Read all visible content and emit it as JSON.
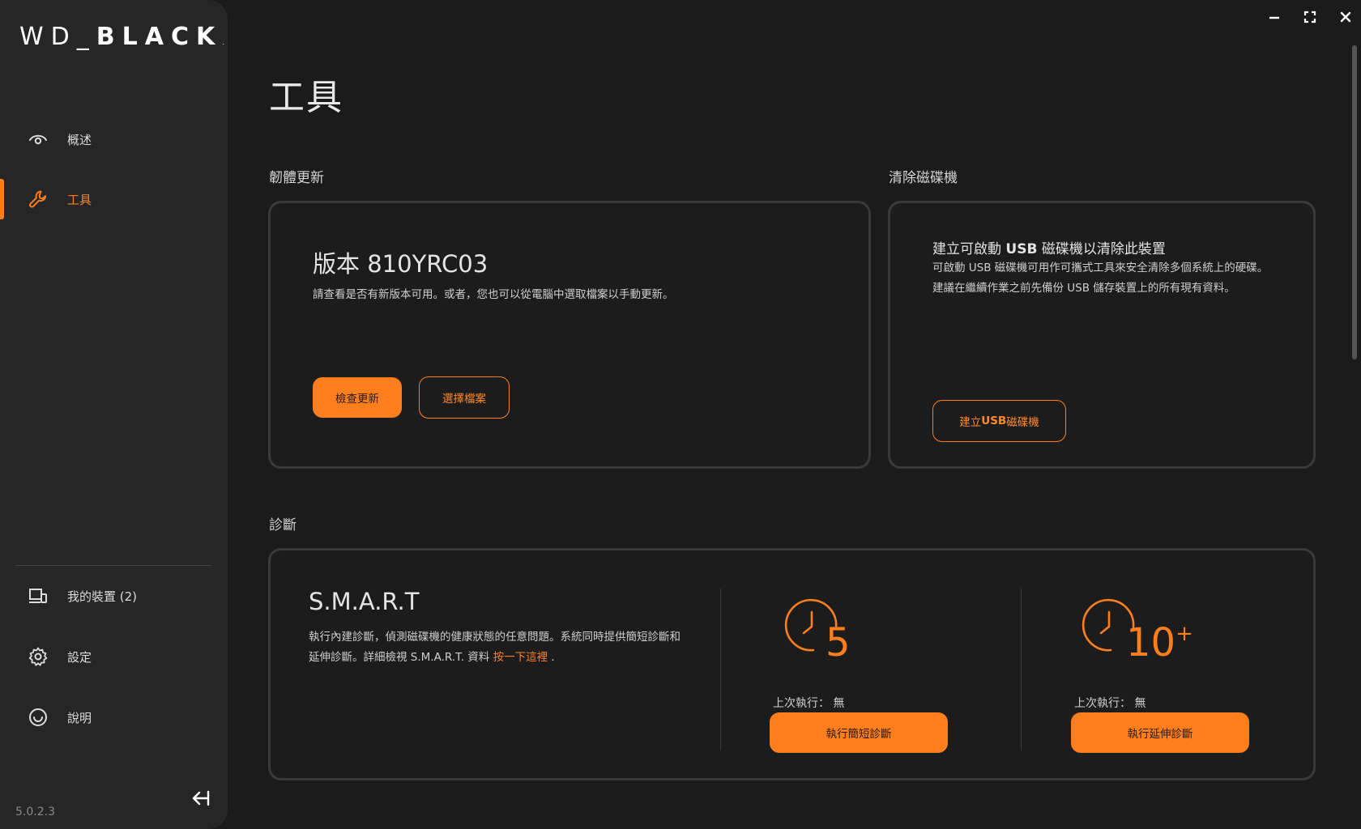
{
  "sidebar": {
    "logo": {
      "part1": "WD_",
      "part2": "BLACK",
      "mark": "."
    },
    "nav": [
      {
        "label": "概述",
        "icon": "eye-icon"
      },
      {
        "label": "工具",
        "icon": "wrench-icon",
        "active": true
      }
    ],
    "bottom_nav": [
      {
        "label": "我的裝置 (2)",
        "icon": "devices-icon"
      },
      {
        "label": "設定",
        "icon": "gear-icon"
      },
      {
        "label": "說明",
        "icon": "help-icon"
      }
    ],
    "version": "5.0.2.3"
  },
  "page": {
    "title": "工具"
  },
  "firmware": {
    "section_label": "韌體更新",
    "heading": "版本 810YRC03",
    "description": "請查看是否有新版本可用。或者，您也可以從電腦中選取檔案以手動更新。",
    "check_button": "檢查更新",
    "select_button": "選擇檔案"
  },
  "erase": {
    "section_label": "清除磁碟機",
    "heading_pre": "建立可啟動 ",
    "heading_bold": "USB",
    "heading_post": " 磁碟機以清除此裝置",
    "description": "可啟動 USB 磁碟機可用作可攜式工具來安全清除多個系統上的硬碟。建議在繼續作業之前先備份 USB 儲存裝置上的所有現有資料。",
    "button_pre": "建立 ",
    "button_bold": "USB",
    "button_post": " 磁碟機"
  },
  "diagnostics": {
    "section_label": "診斷",
    "heading": "S.M.A.R.T",
    "description": "執行內建診斷，偵測磁碟機的健康狀態的任意問題。系統同時提供簡短診斷和延伸診斷。詳細檢視 S.M.A.R.T. 資料 ",
    "link": "按一下這裡",
    "link_suffix": " .",
    "short": {
      "icon_number": "5",
      "last_run_label": "上次執行：",
      "last_run_value": "無",
      "button": "執行簡短診斷"
    },
    "extended": {
      "icon_number": "10",
      "icon_sup": "+",
      "last_run_label": "上次執行：",
      "last_run_value": "無",
      "button": "執行延伸診斷"
    }
  },
  "colors": {
    "accent": "#ff7f1f",
    "background": "#1b1b1b",
    "sidebar": "#262626",
    "card_border": "#3a3a3a"
  }
}
